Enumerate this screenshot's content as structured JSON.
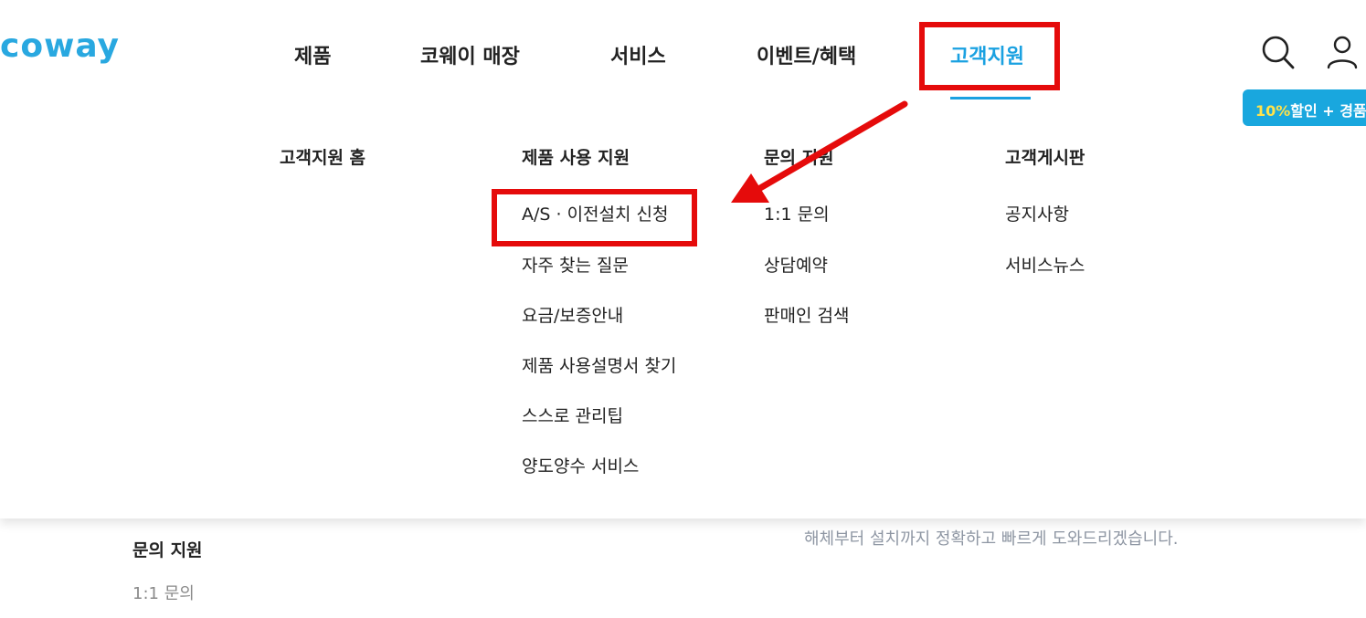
{
  "header": {
    "logo_text": "coway",
    "nav": [
      "제품",
      "코웨이 매장",
      "서비스",
      "이벤트/혜택",
      "고객지원"
    ],
    "promo": {
      "highlight": "10%",
      "rest": "할인 + 경품 하"
    }
  },
  "mega_menu": {
    "columns": [
      {
        "title": "고객지원 홈",
        "items": []
      },
      {
        "title": "제품 사용 지원",
        "items": [
          "A/S · 이전설치 신청",
          "자주 찾는 질문",
          "요금/보증안내",
          "제품 사용설명서 찾기",
          "스스로 관리팁",
          "양도양수 서비스"
        ]
      },
      {
        "title": "문의 지원",
        "items": [
          "1:1 문의",
          "상담예약",
          "판매인 검색"
        ]
      },
      {
        "title": "고객게시판",
        "items": [
          "공지사항",
          "서비스뉴스"
        ]
      }
    ]
  },
  "underlying": {
    "section_title": "문의 지원",
    "link": "1:1 문의",
    "description": "해체부터 설치까지 정확하고 빠르게 도와드리겠습니다."
  },
  "colors": {
    "brand": "#29a8e0",
    "active": "#1aa1e1",
    "annotation": "#e50b0b"
  }
}
